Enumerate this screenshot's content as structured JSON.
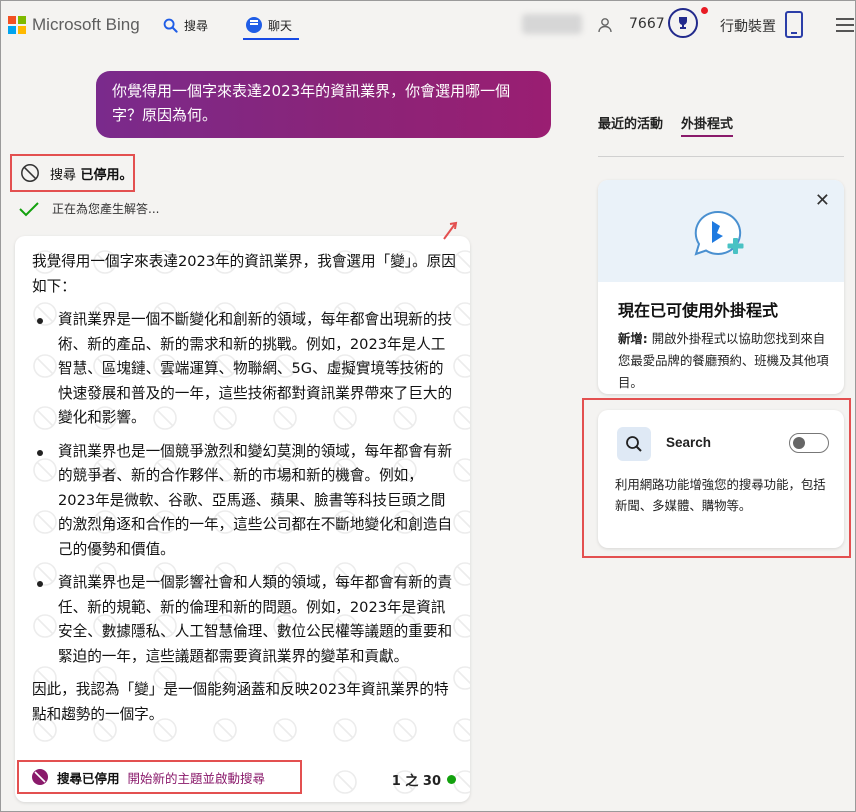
{
  "header": {
    "logo_text": "Microsoft Bing",
    "nav_search_label": "搜尋",
    "nav_chat_label": "聊天",
    "points": "7667",
    "mobile_label": "行動裝置"
  },
  "colors": {
    "brand_blue": "#174ae4",
    "user_bubble_start": "#7a2a8c",
    "user_bubble_end": "#9a1e72",
    "highlight_red": "#e35050",
    "accent_magenta": "#8a1a6b",
    "status_green": "#13a10e"
  },
  "conversation": {
    "user_message": "你覺得用一個字來表達2023年的資訊業界，你會選用哪一個字？原因為何。",
    "search_status_prefix": "搜尋",
    "search_status_suffix": " 已停用。",
    "generating_text": "正在為您產生解答...",
    "answer": {
      "intro": "我覺得用一個字來表達2023年的資訊業界，我會選用「變」。原因如下：",
      "points": [
        "資訊業界是一個不斷變化和創新的領域，每年都會出現新的技術、新的產品、新的需求和新的挑戰。例如，2023年是人工智慧、區塊鏈、雲端運算、物聯網、5G、虛擬實境等技術的快速發展和普及的一年，這些技術都對資訊業界帶來了巨大的變化和影響。",
        "資訊業界也是一個競爭激烈和變幻莫測的領域，每年都會有新的競爭者、新的合作夥伴、新的市場和新的機會。例如，2023年是微軟、谷歌、亞馬遜、蘋果、臉書等科技巨頭之間的激烈角逐和合作的一年，這些公司都在不斷地變化和創造自己的優勢和價值。",
        "資訊業界也是一個影響社會和人類的領域，每年都會有新的責任、新的規範、新的倫理和新的問題。例如，2023年是資訊安全、數據隱私、人工智慧倫理、數位公民權等議題的重要和緊迫的一年，這些議題都需要資訊業界的變革和貢獻。"
      ],
      "conclusion": "因此，我認為「變」是一個能夠涵蓋和反映2023年資訊業界的特點和趨勢的一個字。"
    },
    "footer": {
      "disabled_label": "搜尋已停用",
      "new_topic_link": "開始新的主題並啟動搜尋",
      "counter": "1 之 30"
    }
  },
  "right_panel": {
    "tabs": [
      "最近的活動",
      "外掛程式"
    ],
    "active_tab": "外掛程式",
    "plugin_card": {
      "title": "現在已可使用外掛程式",
      "desc_bold": "新增:",
      "desc": " 開啟外掛程式以協助您找到來自您最愛品牌的餐廳預約、班機及其他項目。"
    },
    "search_plugin": {
      "name": "Search",
      "enabled": false,
      "description": "利用網路功能增強您的搜尋功能，包括新聞、多媒體、購物等。"
    }
  },
  "icons": {
    "logo": "microsoft-logo-icon",
    "nav_search": "search-icon",
    "nav_chat": "chat-bubble-icon",
    "user": "user-icon",
    "rewards": "trophy-icon",
    "mobile": "phone-icon",
    "menu": "hamburger-menu-icon",
    "search_disabled": "search-off-icon",
    "check": "check-icon",
    "close": "close-icon",
    "plugin_bing": "bing-plugin-icon"
  }
}
